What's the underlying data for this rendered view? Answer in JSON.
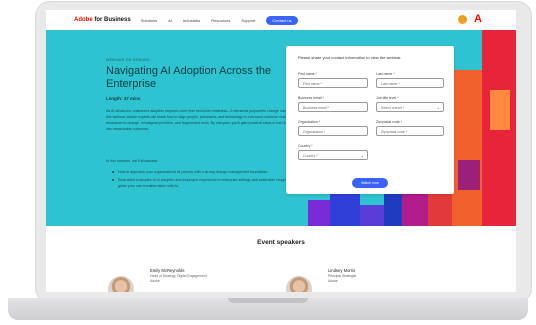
{
  "nav": {
    "brand_prefix": "Adobe",
    "brand_suffix": "for Business",
    "items": [
      "Solutions",
      "AI",
      "Industries",
      "Resources",
      "Support"
    ],
    "cta": "Contact us"
  },
  "hero": {
    "eyebrow": "WEBINAR ON DEMAND",
    "title": "Navigating AI Adoption Across the Enterprise",
    "subtitle": "Length: 47 mins",
    "paragraph": "As AI advances, customers adoption requires more than technical readiness—it demands purposeful change management. In this webinar, Adobe experts will share how to align people, processes, and technology to overcome common challenges like resistance to change, misaligned priorities, and fragmented tools. By mid-year, you'll gain practical steps to turn AI ambitions into measurable outcomes.",
    "learn_heading": "In this session, we'll showcase:",
    "bullets": [
      "How to approach your organization's AI journey with a strong change management foundation.",
      "Real-world examples of AI adoption and employee experience in enterprise settings and actionable insights to guide your own transformation with AI."
    ]
  },
  "form": {
    "heading": "Please share your contact information to view the webinar.",
    "fields": [
      {
        "label": "First name *",
        "placeholder": "First name *",
        "type": "text"
      },
      {
        "label": "Last name *",
        "placeholder": "Last name *",
        "type": "text"
      },
      {
        "label": "Business email *",
        "placeholder": "Business email *",
        "type": "text"
      },
      {
        "label": "Job title level *",
        "placeholder": "Select a level *",
        "type": "select"
      },
      {
        "label": "Organization *",
        "placeholder": "Organization *",
        "type": "text"
      },
      {
        "label": "Zip/postal code *",
        "placeholder": "Zip/postal code *",
        "type": "text"
      },
      {
        "label": "Country *",
        "placeholder": "Country *",
        "type": "select"
      }
    ],
    "submit": "Watch now",
    "chevron": "⌄"
  },
  "speakers": {
    "heading": "Event speakers",
    "list": [
      {
        "name": "Emily McReynolds",
        "role_line1": "Head of Strategy, Digital Engagement",
        "role_line2": "Adobe"
      },
      {
        "name": "Lindsey Morris",
        "role_line1": "Principal Strategist",
        "role_line2": "Adobe"
      }
    ]
  },
  "colors": {
    "hero_bg": "#2ec3d0",
    "accent_blue": "#3b63fb",
    "adobe_red": "#eb1000"
  }
}
